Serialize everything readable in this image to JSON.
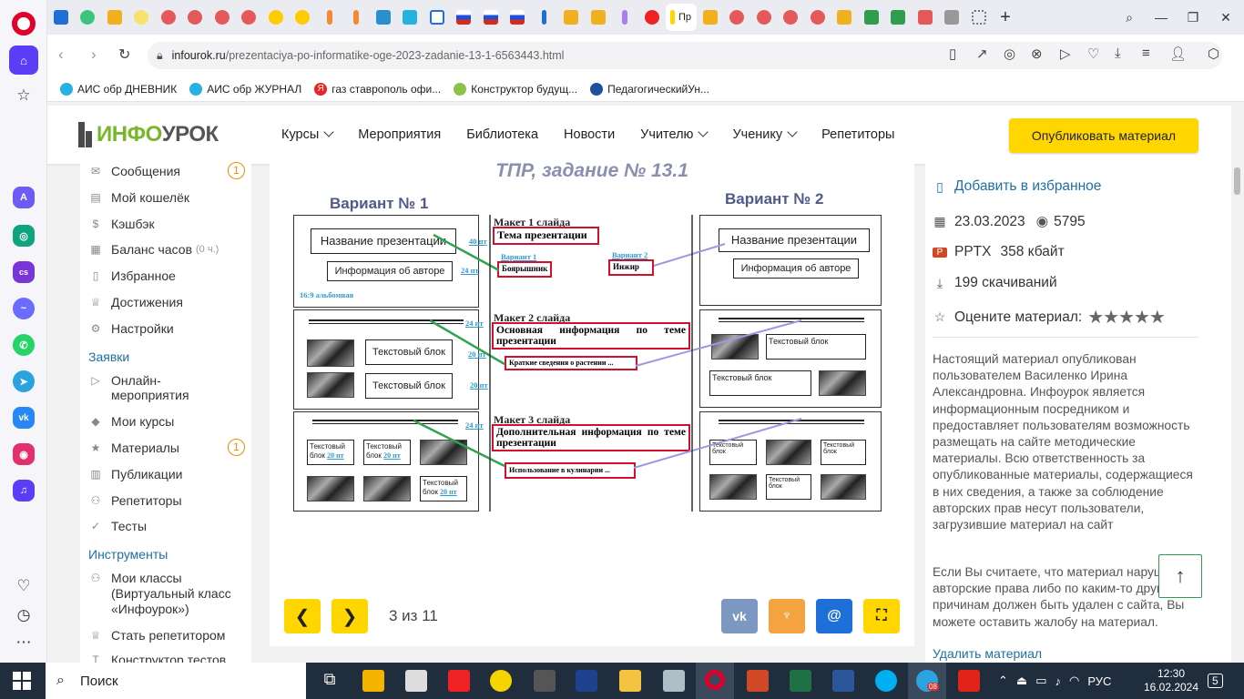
{
  "browser": {
    "url_domain": "infourok.ru",
    "url_path": "/prezentaciya-po-informatike-oge-2023-zadanie-13-1-6563443.html",
    "active_tab_title": "Пр",
    "bookmarks": [
      "АИС обр ДНЕВНИК",
      "АИС обр ЖУРНАЛ",
      "газ ставрополь офи...",
      "Конструктор будущ...",
      "ПедагогическийУн..."
    ]
  },
  "site": {
    "logo_green": "ИНФО",
    "logo_grey": "УРОК",
    "menu": [
      "Курсы",
      "Мероприятия",
      "Библиотека",
      "Новости",
      "Учителю",
      "Ученику",
      "Репетиторы"
    ],
    "publish_label": "Опубликовать материал"
  },
  "sidebar": {
    "items": [
      {
        "label": "Сообщения",
        "badge": "1"
      },
      {
        "label": "Мой кошелёк"
      },
      {
        "label": "Кэшбэк"
      },
      {
        "label": "Баланс часов",
        "note": "(0 ч.)"
      },
      {
        "label": "Избранное"
      },
      {
        "label": "Достижения"
      },
      {
        "label": "Настройки"
      }
    ],
    "section_requests": "Заявки",
    "requests": [
      {
        "label": "Онлайн-мероприятия"
      },
      {
        "label": "Мои курсы"
      },
      {
        "label": "Материалы",
        "badge": "1"
      },
      {
        "label": "Публикации"
      },
      {
        "label": "Репетиторы"
      },
      {
        "label": "Тесты"
      }
    ],
    "section_tools": "Инструменты",
    "tools": [
      {
        "label": "Мои классы (Виртуальный класс «Инфоурок»)"
      },
      {
        "label": "Стать репетитором"
      },
      {
        "label": "Конструктор тестов"
      }
    ]
  },
  "slide": {
    "title": "ТПР, задание № 13.1",
    "variant1": "Вариант № 1",
    "variant2": "Вариант № 2",
    "name_pres": "Название презентации",
    "author_info": "Информация об авторе",
    "pt40": "40 пт",
    "pt24": "24 пт",
    "pt20": "20 пт",
    "album": "16:9 альбомная",
    "text_block": "Текстовый блок",
    "text_block_small": "Текстовый блок",
    "maket1": "Макет 1 слайда",
    "maket2": "Макет 2 слайда",
    "maket3": "Макет 3 слайда",
    "theme": "Тема презентации",
    "v1": "Вариант 1",
    "v2": "Вариант 2",
    "boyar": "Боярышник",
    "inzhir": "Инжир",
    "main_info": "Основная информация по теме презентации",
    "short_info": "Краткие сведения о растении ...",
    "extra_info": "Дополнительная информация по теме презентации",
    "cooking": "Использование в кулинарии ..."
  },
  "slide_nav": {
    "counter": "3 из 11",
    "prev_icon": "chevron-left-icon",
    "next_icon": "chevron-right-icon"
  },
  "share_colors": {
    "vk": "#7b97c2",
    "ok": "#f3a340",
    "mail": "#1f6fd8",
    "full": "#ffd600"
  },
  "info": {
    "favorite": "Добавить в избранное",
    "date": "23.03.2023",
    "views": "5795",
    "format": "PPTX",
    "size": "358 кбайт",
    "downloads": "199 скачиваний",
    "rate": "Оцените материал:",
    "description": "Настоящий материал опубликован пользователем Василенко Ирина Александровна. Инфоурок является информационным посредником и предоставляет пользователям возможность размещать на сайте методические материалы. Всю ответственность за опубликованные материалы, содержащиеся в них сведения, а также за соблюдение авторских прав несут пользователи, загрузившие материал на сайт",
    "complaint": "Если Вы считаете, что материал нарушает авторские права либо по каким-то другим причинам должен быть удален с сайта, Вы можете оставить жалобу на материал.",
    "delete": "Удалить материал"
  },
  "taskbar": {
    "search": "Поиск",
    "lang": "РУС",
    "time": "12:30",
    "date": "16.02.2024",
    "notifications": "5",
    "telegram_badge": "08"
  }
}
